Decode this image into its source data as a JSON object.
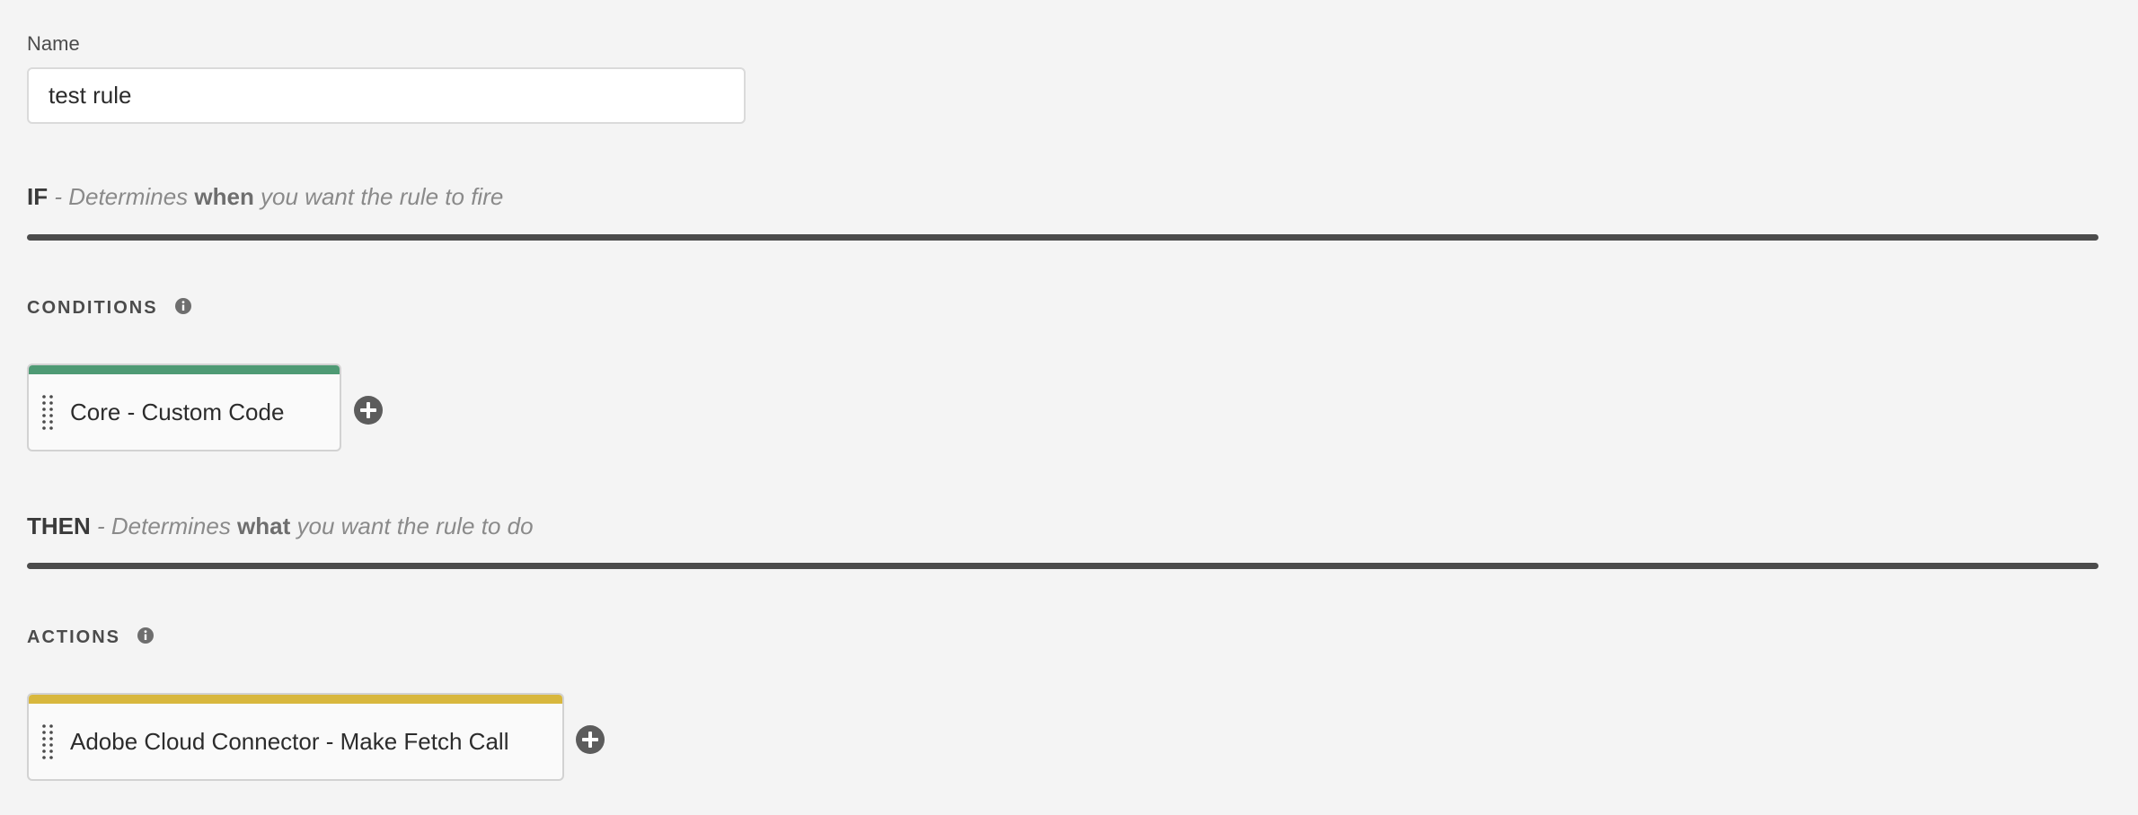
{
  "name_field": {
    "label": "Name",
    "value": "test rule"
  },
  "if_section": {
    "keyword": "IF",
    "desc_pre": " - Determines ",
    "desc_emph": "when",
    "desc_post": " you want the rule to fire"
  },
  "conditions": {
    "heading": "CONDITIONS",
    "items": [
      {
        "label": "Core - Custom Code",
        "accent_color": "#4e9a74"
      }
    ]
  },
  "then_section": {
    "keyword": "THEN",
    "desc_pre": " - Determines ",
    "desc_emph": "what",
    "desc_post": " you want the rule to do"
  },
  "actions": {
    "heading": "ACTIONS",
    "items": [
      {
        "label": "Adobe Cloud Connector - Make Fetch Call",
        "accent_color": "#d8b73d"
      }
    ]
  },
  "icons": {
    "info": "info-icon",
    "add": "add-circle-icon",
    "drag": "drag-handle-icon"
  }
}
